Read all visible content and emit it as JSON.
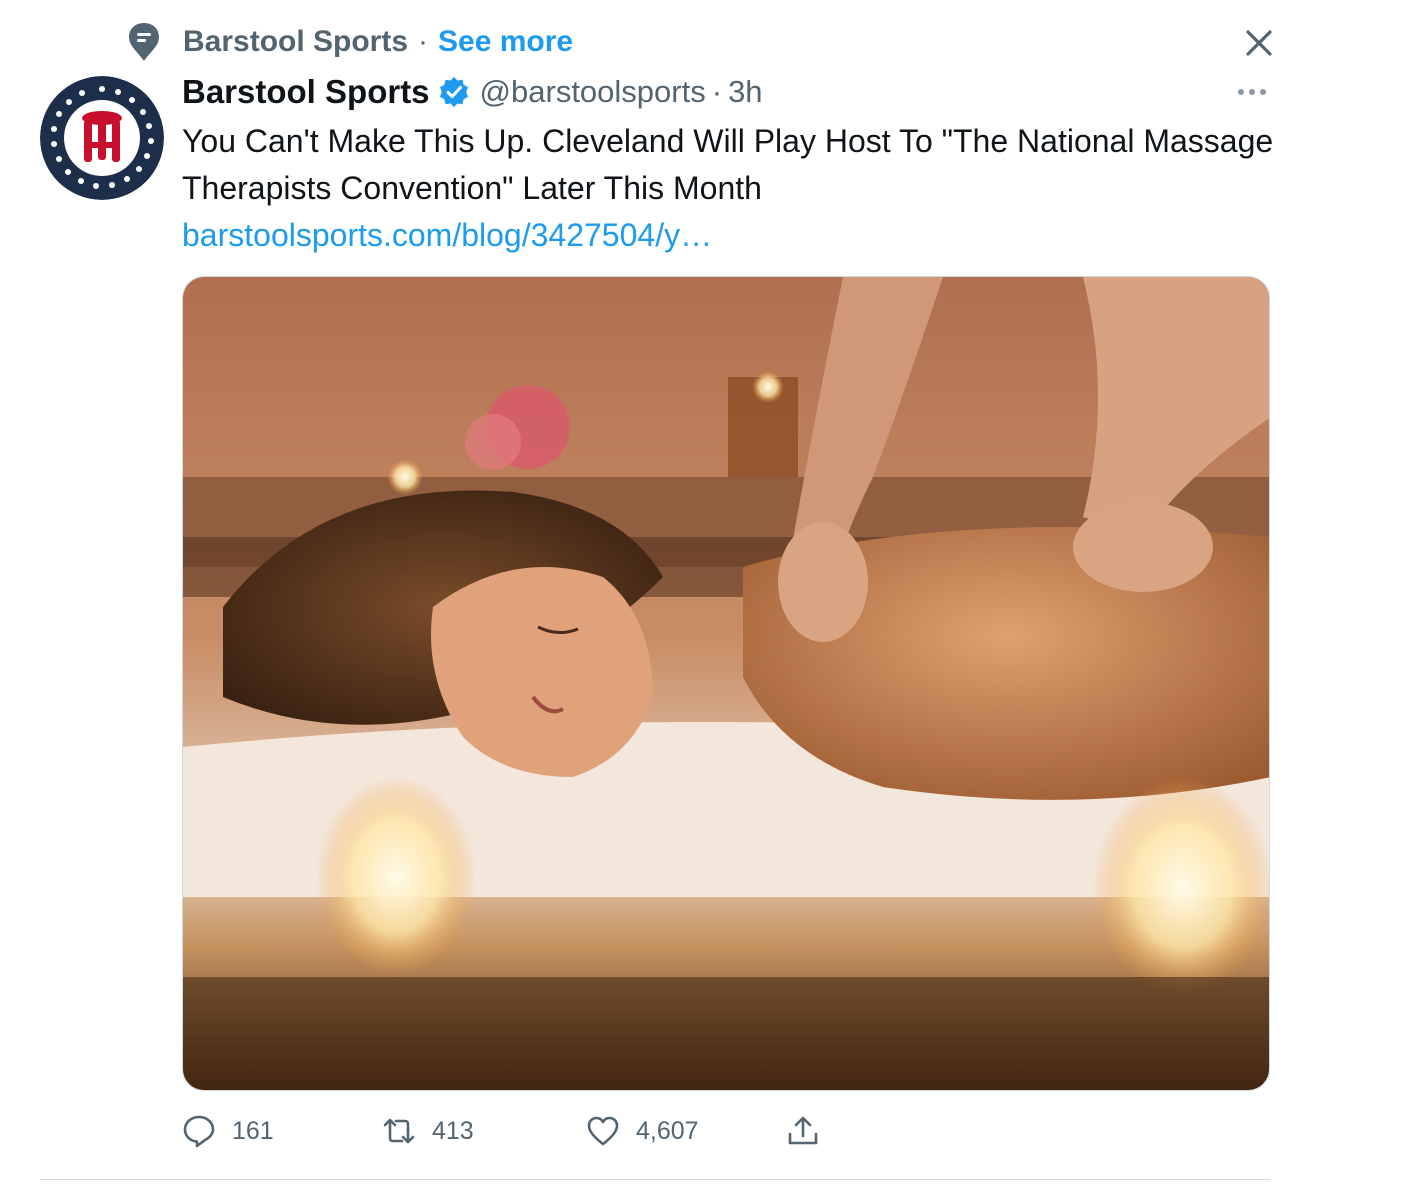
{
  "topic": {
    "name": "Barstool Sports",
    "separator": "·",
    "see_more": "See more"
  },
  "tweet": {
    "author_name": "Barstool Sports",
    "handle": "@barstoolsports",
    "separator": "·",
    "time": "3h",
    "text": "You Can't Make This Up. Cleveland Will Play Host To \"The National Massage Therapists Convention\" Later This Month ",
    "link_text": "barstoolsports.com/blog/3427504/y…",
    "verified": true
  },
  "actions": {
    "replies": "161",
    "retweets": "413",
    "likes": "4,607"
  },
  "icons": {
    "topic": "topic-icon",
    "close": "close-icon",
    "verified": "verified-badge-icon",
    "more": "more-options-icon",
    "reply": "reply-icon",
    "retweet": "retweet-icon",
    "like": "heart-icon",
    "share": "share-icon"
  },
  "colors": {
    "accent": "#1d9bf0",
    "secondary_text": "#536471",
    "primary_text": "#0f1419",
    "logo_navy": "#1c2e4a",
    "logo_red": "#c8102e"
  }
}
